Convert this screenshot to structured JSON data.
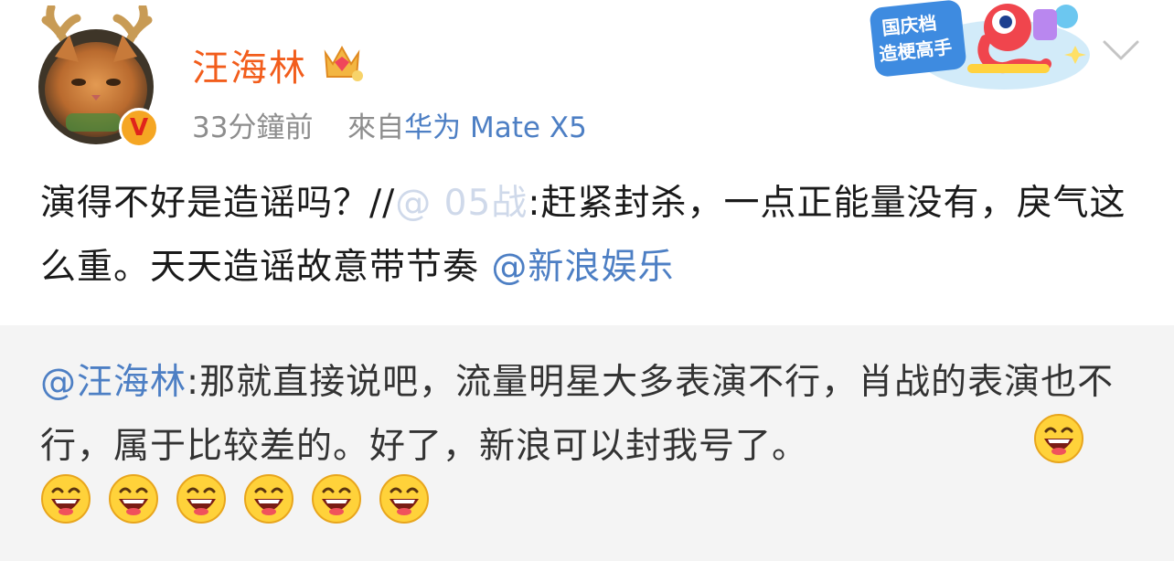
{
  "post_header": {
    "username": "汪海林",
    "time": "33分鐘前",
    "source_prefix": "來自",
    "source_device": "华为 Mate X5"
  },
  "promo_badge": {
    "line1": "国庆档",
    "line2": "造梗高手"
  },
  "post_body": {
    "text_part1": "演得不好是造谣吗？//",
    "blurred_mention": "@     05战",
    "text_part2": ":赶紧封杀，一点正能量没有，戾气这么重。天天造谣故意带节奏",
    "mention": "@新浪娱乐"
  },
  "repost": {
    "mention": "@汪海林",
    "text": ":那就直接说吧，流量明星大多表演不行，肖战的表演也不行，属于比较差的。好了，新浪可以封我号了。",
    "emoji_count": 7,
    "emoji_name": "laughing-emoji"
  },
  "colors": {
    "username": "#f25d1c",
    "link": "#4d7fc4",
    "meta": "#8d8d8d",
    "repost_bg": "#f4f4f4"
  }
}
